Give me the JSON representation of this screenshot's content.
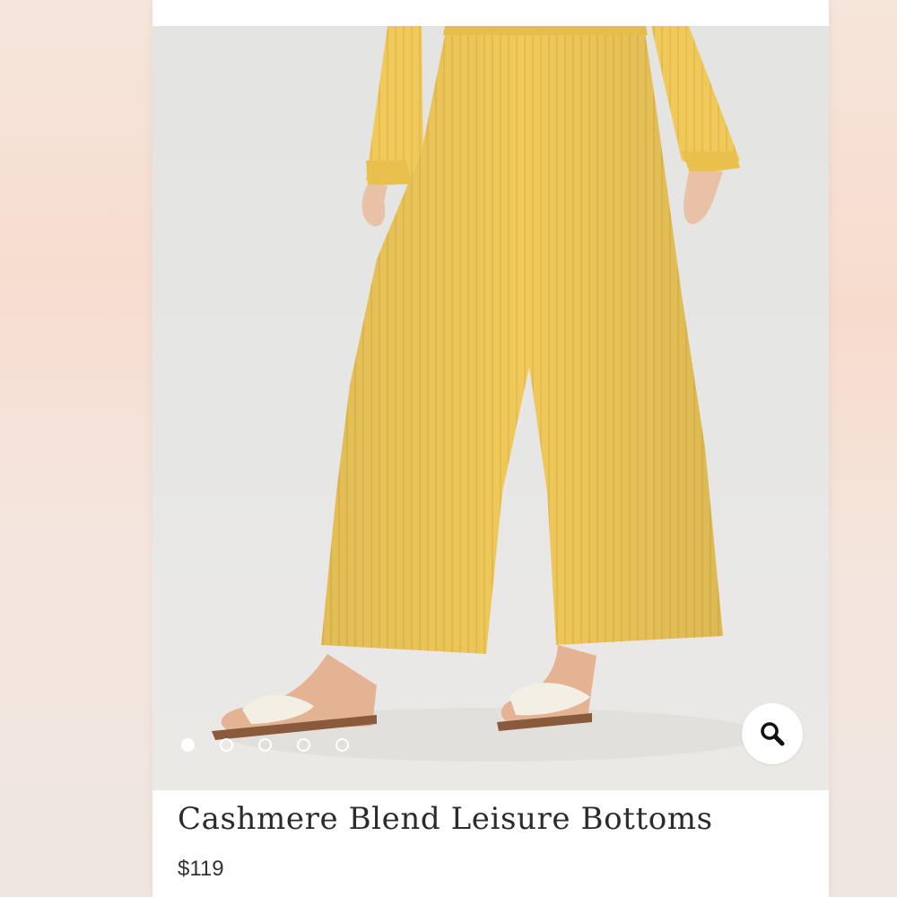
{
  "product": {
    "title": "Cashmere Blend Leisure Bottoms",
    "price": "$119"
  },
  "gallery": {
    "image_count": 5,
    "active_index": 0,
    "zoom_icon": "search-icon"
  },
  "colors": {
    "garment": "#f0c95a",
    "background": "#e5e5e3",
    "text": "#2b2b2b"
  }
}
